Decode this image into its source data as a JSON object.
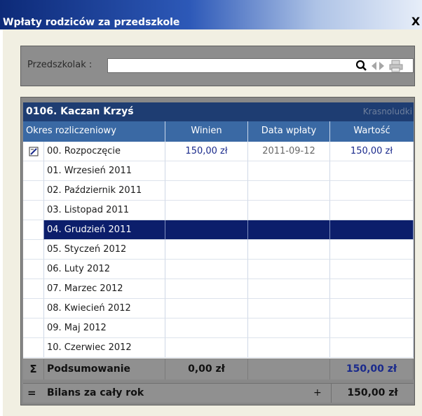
{
  "window": {
    "title": "Wpłaty rodziców za przedszkole",
    "close_label": "X"
  },
  "search": {
    "label": "Przedszkolak :",
    "value": "",
    "icons": [
      "search-icon",
      "prev-arrow-icon",
      "next-arrow-icon",
      "printer-icon"
    ]
  },
  "student": {
    "name": "0106. Kaczan Krzyś",
    "group": "Krasnoludki"
  },
  "table": {
    "columns": [
      "Okres rozliczeniowy",
      "Winien",
      "Data wpłaty",
      "Wartość"
    ],
    "rows": [
      {
        "okres": "00. Rozpoczęcie",
        "winien": "150,00 zł",
        "data": "2011-09-12",
        "wartosc": "150,00 zł",
        "icon": "edit-icon"
      },
      {
        "okres": "01. Wrzesień 2011",
        "winien": "",
        "data": "",
        "wartosc": ""
      },
      {
        "okres": "02. Październik 2011",
        "winien": "",
        "data": "",
        "wartosc": ""
      },
      {
        "okres": "03. Listopad 2011",
        "winien": "",
        "data": "",
        "wartosc": ""
      },
      {
        "okres": "04. Grudzień 2011",
        "winien": "",
        "data": "",
        "wartosc": "",
        "selected": true
      },
      {
        "okres": "05. Styczeń 2012",
        "winien": "",
        "data": "",
        "wartosc": ""
      },
      {
        "okres": "06. Luty 2012",
        "winien": "",
        "data": "",
        "wartosc": ""
      },
      {
        "okres": "07. Marzec 2012",
        "winien": "",
        "data": "",
        "wartosc": ""
      },
      {
        "okres": "08. Kwiecień 2012",
        "winien": "",
        "data": "",
        "wartosc": ""
      },
      {
        "okres": "09. Maj 2012",
        "winien": "",
        "data": "",
        "wartosc": ""
      },
      {
        "okres": "10. Czerwiec 2012",
        "winien": "",
        "data": "",
        "wartosc": ""
      }
    ]
  },
  "summary": {
    "symbol": "Σ",
    "label": "Podsumowanie",
    "winien": "0,00 zł",
    "data": "",
    "wartosc": "150,00 zł"
  },
  "balance": {
    "symbol": "=",
    "label": "Bilans za cały rok",
    "sign": "+",
    "value": "150,00 zł"
  },
  "colors": {
    "title_gradient_start": "#0d2a78",
    "header_blue": "#3a69a4",
    "selected_row": "#0c1e6b",
    "value_blue": "#1a2a8c"
  }
}
